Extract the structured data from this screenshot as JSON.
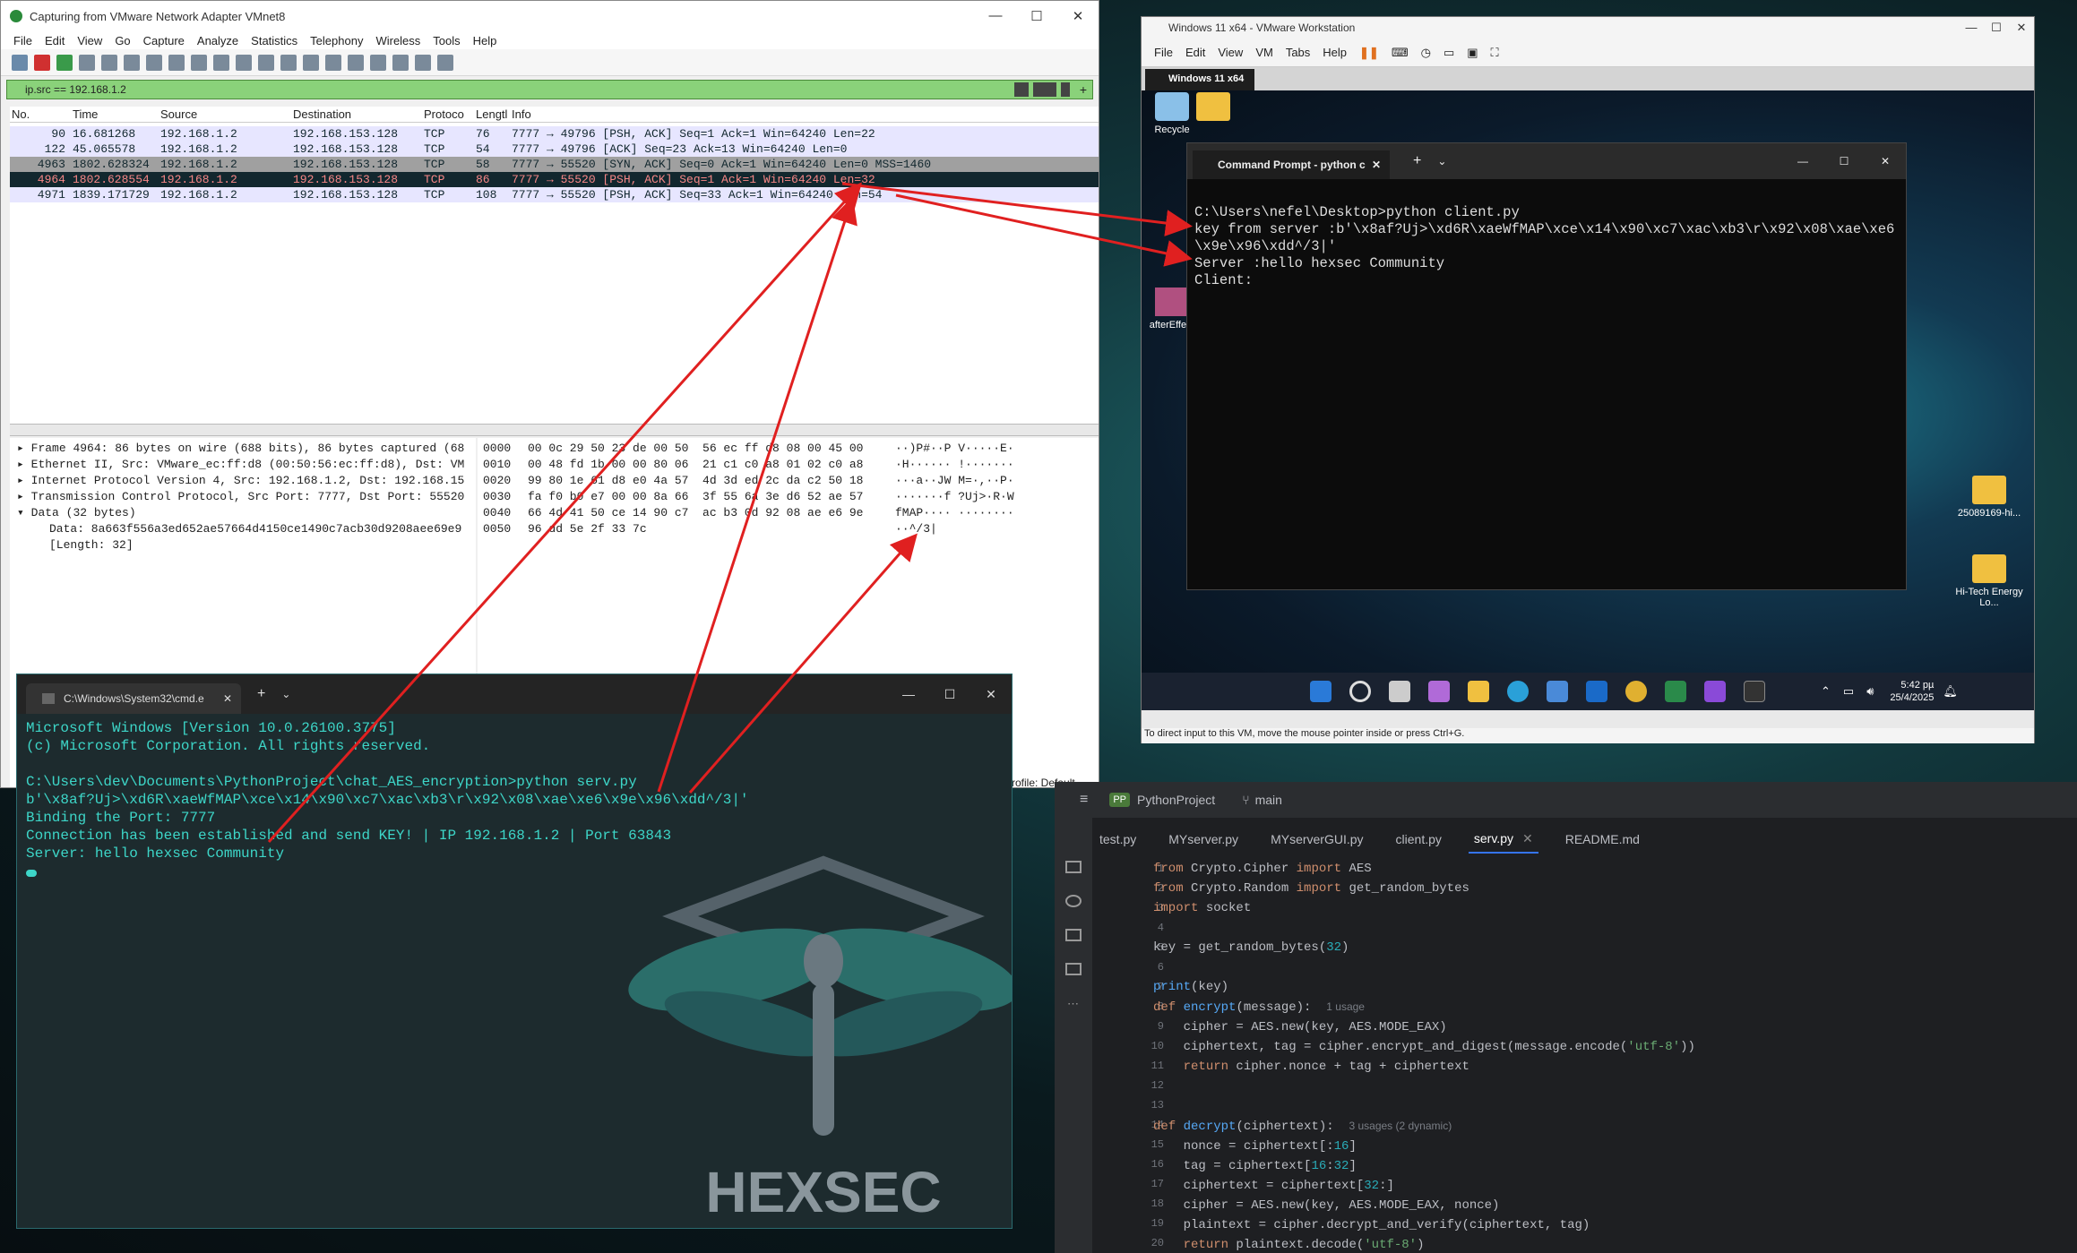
{
  "wireshark": {
    "title": "Capturing from VMware Network Adapter VMnet8",
    "menu": [
      "File",
      "Edit",
      "View",
      "Go",
      "Capture",
      "Analyze",
      "Statistics",
      "Telephony",
      "Wireless",
      "Tools",
      "Help"
    ],
    "filter": "ip.src == 192.168.1.2",
    "columns": [
      "No.",
      "Time",
      "Source",
      "Destination",
      "Protoco",
      "Lengtl",
      "Info"
    ],
    "packets": [
      {
        "no": "90",
        "time": "16.681268",
        "src": "192.168.1.2",
        "dst": "192.168.153.128",
        "proto": "TCP",
        "len": "76",
        "info": "7777 → 49796 [PSH, ACK] Seq=1 Ack=1 Win=64240 Len=22"
      },
      {
        "no": "122",
        "time": "45.065578",
        "src": "192.168.1.2",
        "dst": "192.168.153.128",
        "proto": "TCP",
        "len": "54",
        "info": "7777 → 49796 [ACK] Seq=23 Ack=13 Win=64240 Len=0"
      },
      {
        "no": "4963",
        "time": "1802.628324",
        "src": "192.168.1.2",
        "dst": "192.168.153.128",
        "proto": "TCP",
        "len": "58",
        "info": "7777 → 55520 [SYN, ACK] Seq=0 Ack=1 Win=64240 Len=0 MSS=1460"
      },
      {
        "no": "4964",
        "time": "1802.628554",
        "src": "192.168.1.2",
        "dst": "192.168.153.128",
        "proto": "TCP",
        "len": "86",
        "info": "7777 → 55520 [PSH, ACK] Seq=1 Ack=1 Win=64240 Len=32"
      },
      {
        "no": "4971",
        "time": "1839.171729",
        "src": "192.168.1.2",
        "dst": "192.168.153.128",
        "proto": "TCP",
        "len": "108",
        "info": "7777 → 55520 [PSH, ACK] Seq=33 Ack=1 Win=64240 Len=54"
      }
    ],
    "details": [
      "Frame 4964: 86 bytes on wire (688 bits), 86 bytes captured (68",
      "Ethernet II, Src: VMware_ec:ff:d8 (00:50:56:ec:ff:d8), Dst: VM",
      "Internet Protocol Version 4, Src: 192.168.1.2, Dst: 192.168.15",
      "Transmission Control Protocol, Src Port: 7777, Dst Port: 55520",
      "Data (32 bytes)",
      "Data: 8a663f556a3ed652ae57664d4150ce1490c7acb30d9208aee69e9",
      "[Length: 32]"
    ],
    "hex_offsets": [
      "0000",
      "0010",
      "0020",
      "0030",
      "0040",
      "0050"
    ],
    "hex_bytes": [
      "00 0c 29 50 23 de 00 50  56 ec ff d8 08 00 45 00",
      "00 48 fd 1b 00 00 80 06  21 c1 c0 a8 01 02 c0 a8",
      "99 80 1e 61 d8 e0 4a 57  4d 3d ed 2c da c2 50 18",
      "fa f0 b0 e7 00 00 8a 66  3f 55 6a 3e d6 52 ae 57",
      "66 4d 41 50 ce 14 90 c7  ac b3 0d 92 08 ae e6 9e",
      "96 dd 5e 2f 33 7c"
    ],
    "hex_ascii": [
      "··)P#··P V·····E·",
      "·H······ !·······",
      "···a··JW M=·,··P·",
      "·······f ?Uj>·R·W",
      "fMAP···· ········",
      "··^/3|"
    ],
    "profile": "rofile: Default"
  },
  "host_cmd": {
    "tab_title": "C:\\Windows\\System32\\cmd.e",
    "lines": [
      "Microsoft Windows [Version 10.0.26100.3775]",
      "(c) Microsoft Corporation. All rights reserved.",
      "",
      "C:\\Users\\dev\\Documents\\PythonProject\\chat_AES_encryption>python serv.py",
      "b'\\x8af?Uj>\\xd6R\\xaeWfMAP\\xce\\x14\\x90\\xc7\\xac\\xb3\\r\\x92\\x08\\xae\\xe6\\x9e\\x96\\xdd^/3|'",
      "Binding the Port: 7777",
      "Connection has been established and send KEY! | IP 192.168.1.2 | Port 63843",
      "Server: hello hexsec Community"
    ],
    "logo_text": "HEXSEC"
  },
  "vmware": {
    "title": "Windows 11 x64 - VMware Workstation",
    "menu": [
      "File",
      "Edit",
      "View",
      "VM",
      "Tabs",
      "Help"
    ],
    "vm_tab": "Windows 11 x64",
    "status": "To direct input to this VM, move the mouse pointer inside or press Ctrl+G.",
    "desktop_icons": {
      "recycle": "Recycle",
      "after": "afterEffe...",
      "folder1": "25089169-hi...",
      "folder2": "Hi-Tech Energy Lo..."
    },
    "clock_time": "5:42 pµ",
    "clock_date": "25/4/2025",
    "guest_cmd": {
      "tab_title": "Command Prompt - python c",
      "lines": [
        "C:\\Users\\nefel\\Desktop>python client.py",
        "key from server :b'\\x8af?Uj>\\xd6R\\xaeWfMAP\\xce\\x14\\x90\\xc7\\xac\\xb3\\r\\x92\\x08\\xae\\xe6\\x9e\\x96\\xdd^/3|'",
        "Server :hello hexsec Community",
        "Client:"
      ]
    }
  },
  "pycharm": {
    "project": "PythonProject",
    "branch": "main",
    "tabs": [
      "test.py",
      "MYserver.py",
      "MYserverGUI.py",
      "client.py",
      "serv.py",
      "README.md"
    ],
    "active_tab": "serv.py",
    "hints": {
      "usage1": "1 usage",
      "usage3": "3 usages (2 dynamic)"
    }
  },
  "colors": {
    "accent": "#e02020",
    "filter_bg": "#8ad27a",
    "terminal_teal": "#3dd6c8"
  }
}
